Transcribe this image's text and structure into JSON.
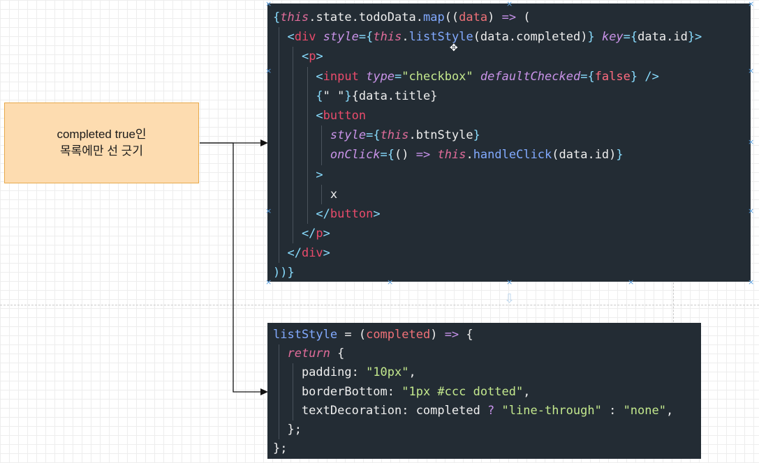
{
  "note": {
    "line1": "completed true인",
    "line2": "목록에만 선 긋기"
  },
  "code_block_1": {
    "lines": [
      [
        {
          "t": "{",
          "c": "punc"
        },
        {
          "t": "this",
          "c": "kw"
        },
        {
          "t": ".state.todoData.",
          "c": "plain"
        },
        {
          "t": "map",
          "c": "fn"
        },
        {
          "t": "((",
          "c": "plain"
        },
        {
          "t": "data",
          "c": "param"
        },
        {
          "t": ") ",
          "c": "plain"
        },
        {
          "t": "=>",
          "c": "op"
        },
        {
          "t": " (",
          "c": "plain"
        }
      ],
      [
        {
          "t": "  <",
          "c": "punc"
        },
        {
          "t": "div",
          "c": "tag"
        },
        {
          "t": " ",
          "c": "plain"
        },
        {
          "t": "style",
          "c": "attr"
        },
        {
          "t": "={",
          "c": "punc"
        },
        {
          "t": "this",
          "c": "kw"
        },
        {
          "t": ".",
          "c": "plain"
        },
        {
          "t": "listStyle",
          "c": "fn"
        },
        {
          "t": "(data.completed)",
          "c": "plain"
        },
        {
          "t": "}",
          "c": "punc"
        },
        {
          "t": " ",
          "c": "plain"
        },
        {
          "t": "key",
          "c": "attr"
        },
        {
          "t": "={",
          "c": "punc"
        },
        {
          "t": "data.id",
          "c": "plain"
        },
        {
          "t": "}>",
          "c": "punc"
        }
      ],
      [
        {
          "t": "    <",
          "c": "punc"
        },
        {
          "t": "p",
          "c": "tag"
        },
        {
          "t": ">",
          "c": "punc"
        }
      ],
      [
        {
          "t": "      <",
          "c": "punc"
        },
        {
          "t": "input",
          "c": "tag"
        },
        {
          "t": " ",
          "c": "plain"
        },
        {
          "t": "type",
          "c": "attr"
        },
        {
          "t": "=",
          "c": "punc"
        },
        {
          "t": "\"checkbox\"",
          "c": "str"
        },
        {
          "t": " ",
          "c": "plain"
        },
        {
          "t": "defaultChecked",
          "c": "attr"
        },
        {
          "t": "={",
          "c": "punc"
        },
        {
          "t": "false",
          "c": "bool"
        },
        {
          "t": "}",
          "c": "punc"
        },
        {
          "t": " />",
          "c": "punc"
        }
      ],
      [
        {
          "t": "      {",
          "c": "punc"
        },
        {
          "t": "\" \"",
          "c": "plain"
        },
        {
          "t": "}",
          "c": "punc"
        },
        {
          "t": "{data.title}",
          "c": "plain"
        }
      ],
      [
        {
          "t": "      <",
          "c": "punc"
        },
        {
          "t": "button",
          "c": "tag"
        }
      ],
      [
        {
          "t": "        ",
          "c": "plain"
        },
        {
          "t": "style",
          "c": "attr"
        },
        {
          "t": "={",
          "c": "punc"
        },
        {
          "t": "this",
          "c": "kw"
        },
        {
          "t": ".btnStyle",
          "c": "plain"
        },
        {
          "t": "}",
          "c": "punc"
        }
      ],
      [
        {
          "t": "        ",
          "c": "plain"
        },
        {
          "t": "onClick",
          "c": "attr"
        },
        {
          "t": "={",
          "c": "punc"
        },
        {
          "t": "() ",
          "c": "plain"
        },
        {
          "t": "=>",
          "c": "op"
        },
        {
          "t": " ",
          "c": "plain"
        },
        {
          "t": "this",
          "c": "kw"
        },
        {
          "t": ".",
          "c": "plain"
        },
        {
          "t": "handleClick",
          "c": "fn"
        },
        {
          "t": "(data.id)",
          "c": "plain"
        },
        {
          "t": "}",
          "c": "punc"
        }
      ],
      [
        {
          "t": "      >",
          "c": "punc"
        }
      ],
      [
        {
          "t": "        x",
          "c": "plain"
        }
      ],
      [
        {
          "t": "      </",
          "c": "punc"
        },
        {
          "t": "button",
          "c": "tag"
        },
        {
          "t": ">",
          "c": "punc"
        }
      ],
      [
        {
          "t": "    </",
          "c": "punc"
        },
        {
          "t": "p",
          "c": "tag"
        },
        {
          "t": ">",
          "c": "punc"
        }
      ],
      [
        {
          "t": "  </",
          "c": "punc"
        },
        {
          "t": "div",
          "c": "tag"
        },
        {
          "t": ">",
          "c": "punc"
        }
      ],
      [
        {
          "t": "))}",
          "c": "punc"
        }
      ]
    ]
  },
  "code_block_2": {
    "lines": [
      [
        {
          "t": "listStyle",
          "c": "fn"
        },
        {
          "t": " = (",
          "c": "plain"
        },
        {
          "t": "completed",
          "c": "param"
        },
        {
          "t": ") ",
          "c": "plain"
        },
        {
          "t": "=>",
          "c": "op"
        },
        {
          "t": " {",
          "c": "plain"
        }
      ],
      [
        {
          "t": "  ",
          "c": "plain"
        },
        {
          "t": "return",
          "c": "kw"
        },
        {
          "t": " {",
          "c": "plain"
        }
      ],
      [
        {
          "t": "    padding: ",
          "c": "plain"
        },
        {
          "t": "\"10px\"",
          "c": "str"
        },
        {
          "t": ",",
          "c": "plain"
        }
      ],
      [
        {
          "t": "    borderBottom: ",
          "c": "plain"
        },
        {
          "t": "\"1px #ccc dotted\"",
          "c": "str"
        },
        {
          "t": ",",
          "c": "plain"
        }
      ],
      [
        {
          "t": "    textDecoration: completed ",
          "c": "plain"
        },
        {
          "t": "?",
          "c": "op"
        },
        {
          "t": " ",
          "c": "plain"
        },
        {
          "t": "\"line-through\"",
          "c": "str"
        },
        {
          "t": " : ",
          "c": "plain"
        },
        {
          "t": "\"none\"",
          "c": "str"
        },
        {
          "t": ",",
          "c": "plain"
        }
      ],
      [
        {
          "t": "  };",
          "c": "plain"
        }
      ],
      [
        {
          "t": "};",
          "c": "plain"
        }
      ]
    ]
  }
}
